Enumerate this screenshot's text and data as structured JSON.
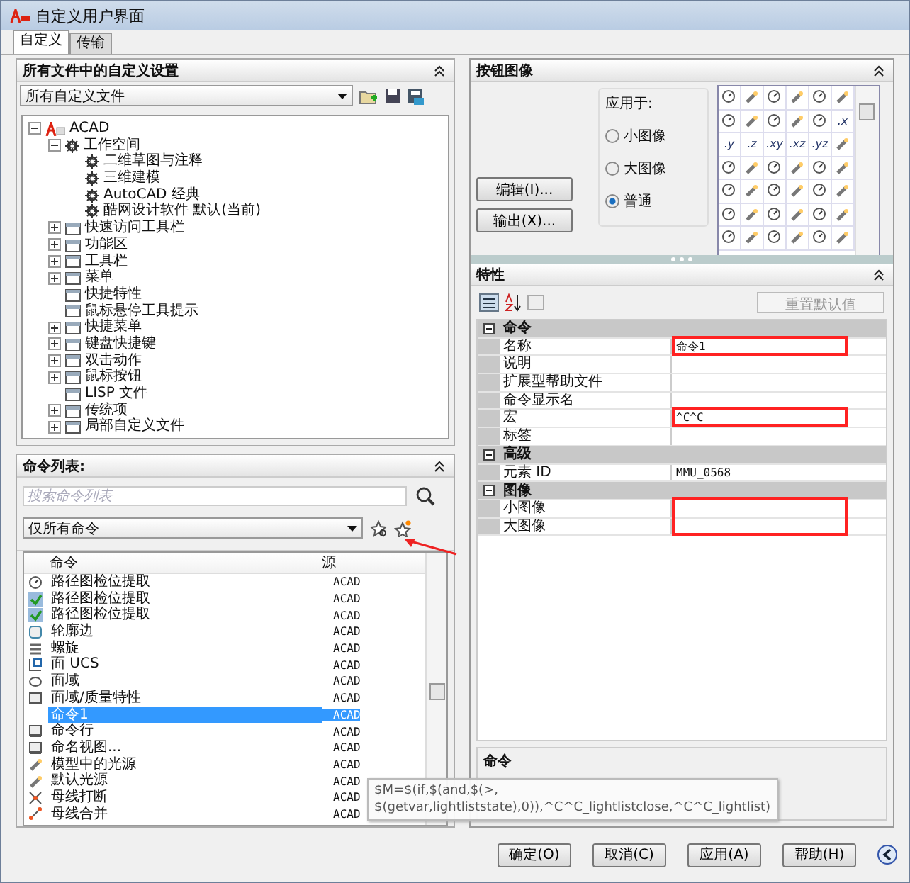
{
  "window": {
    "title": "自定义用户界面"
  },
  "tabs": [
    {
      "label": "自定义",
      "selected": true
    },
    {
      "label": "传输",
      "selected": false
    }
  ],
  "customizations_panel": {
    "title": "所有文件中的自定义设置",
    "file_select": "所有自定义文件",
    "tree": [
      {
        "label": "ACAD",
        "expanded": true,
        "children": [
          {
            "label": "工作空间",
            "expanded": true,
            "children": [
              {
                "label": "二维草图与注释"
              },
              {
                "label": "三维建模"
              },
              {
                "label": "AutoCAD 经典"
              },
              {
                "label": "酷网设计软件 默认(当前)"
              }
            ]
          },
          {
            "label": "快速访问工具栏",
            "expanded": false
          },
          {
            "label": "功能区",
            "expanded": false
          },
          {
            "label": "工具栏",
            "expanded": false
          },
          {
            "label": "菜单",
            "expanded": false
          },
          {
            "label": "快捷特性"
          },
          {
            "label": "鼠标悬停工具提示"
          },
          {
            "label": "快捷菜单",
            "expanded": false
          },
          {
            "label": "键盘快捷键",
            "expanded": false
          },
          {
            "label": "双击动作",
            "expanded": false
          },
          {
            "label": "鼠标按钮",
            "expanded": false
          },
          {
            "label": "LISP 文件"
          },
          {
            "label": "传统项",
            "expanded": false
          },
          {
            "label": "局部自定义文件",
            "expanded": false
          }
        ]
      }
    ]
  },
  "command_list": {
    "title": "命令列表:",
    "search": {
      "placeholder": "搜索命令列表"
    },
    "filter": "仅所有命令",
    "pointer_arrow": true,
    "columns": [
      "命令",
      "源"
    ],
    "rows": [
      {
        "name": "路径图检位提取",
        "source": "ACAD",
        "icon": true,
        "selected": false
      },
      {
        "name": "路径图检位提取",
        "source": "ACAD",
        "icon": true,
        "selected": false
      },
      {
        "name": "路径图检位提取",
        "source": "ACAD",
        "icon": true,
        "selected": false
      },
      {
        "name": "轮廓边",
        "source": "ACAD",
        "icon": true,
        "selected": false
      },
      {
        "name": "螺旋",
        "source": "ACAD",
        "icon": true,
        "selected": false
      },
      {
        "name": "面 UCS",
        "source": "ACAD",
        "icon": true,
        "selected": false
      },
      {
        "name": "面域",
        "source": "ACAD",
        "icon": true,
        "selected": false
      },
      {
        "name": "面域/质量特性",
        "source": "ACAD",
        "icon": true,
        "selected": false
      },
      {
        "name": "命令1",
        "source": "ACAD",
        "icon": false,
        "selected": true
      },
      {
        "name": "命令行",
        "source": "ACAD",
        "icon": true,
        "selected": false
      },
      {
        "name": "命名视图...",
        "source": "ACAD",
        "icon": true,
        "selected": false
      },
      {
        "name": "模型中的光源",
        "source": "ACAD",
        "icon": true,
        "selected": false
      },
      {
        "name": "默认光源",
        "source": "ACAD",
        "icon": true,
        "selected": false
      },
      {
        "name": "母线打断",
        "source": "ACAD",
        "icon": true,
        "selected": false
      },
      {
        "name": "母线合并",
        "source": "ACAD",
        "icon": true,
        "selected": false
      }
    ]
  },
  "button_image_panel": {
    "title": "按钮图像",
    "buttons": [
      "编辑(I)...",
      "输出(X)..."
    ],
    "apply_to_label": "应用于:",
    "apply_to": [
      {
        "label": "小图像",
        "selected": false
      },
      {
        "label": "大图像",
        "selected": false
      },
      {
        "label": "普通",
        "selected": true
      }
    ],
    "images": [
      {
        "kind": "icon"
      },
      {
        "kind": "icon"
      },
      {
        "kind": "icon"
      },
      {
        "kind": "icon"
      },
      {
        "kind": "icon"
      },
      {
        "kind": "icon"
      },
      {
        "kind": "icon"
      },
      {
        "kind": "icon"
      },
      {
        "kind": "icon"
      },
      {
        "kind": "icon"
      },
      {
        "kind": "icon"
      },
      {
        "kind": "text",
        "label": ".x"
      },
      {
        "kind": "text",
        "label": ".y"
      },
      {
        "kind": "text",
        "label": ".z"
      },
      {
        "kind": "text",
        "label": ".xy"
      },
      {
        "kind": "text",
        "label": ".xz"
      },
      {
        "kind": "text",
        "label": ".yz"
      },
      {
        "kind": "icon"
      },
      {
        "kind": "icon"
      },
      {
        "kind": "icon"
      },
      {
        "kind": "icon"
      },
      {
        "kind": "icon"
      },
      {
        "kind": "icon"
      },
      {
        "kind": "icon"
      },
      {
        "kind": "icon"
      },
      {
        "kind": "icon"
      },
      {
        "kind": "icon"
      },
      {
        "kind": "icon"
      },
      {
        "kind": "icon"
      },
      {
        "kind": "icon"
      },
      {
        "kind": "icon"
      },
      {
        "kind": "icon"
      },
      {
        "kind": "icon"
      },
      {
        "kind": "icon"
      },
      {
        "kind": "icon"
      },
      {
        "kind": "icon"
      },
      {
        "kind": "icon"
      },
      {
        "kind": "icon"
      },
      {
        "kind": "icon"
      },
      {
        "kind": "icon"
      },
      {
        "kind": "icon"
      },
      {
        "kind": "icon"
      }
    ]
  },
  "properties_panel": {
    "title": "特性",
    "reset_button": {
      "label": "重置默认值",
      "disabled": true
    },
    "rows": [
      {
        "kind": "category",
        "label": "命令"
      },
      {
        "kind": "property",
        "label": "名称",
        "value": "命令1",
        "highlighted": true
      },
      {
        "kind": "property",
        "label": "说明",
        "highlighted": false
      },
      {
        "kind": "property",
        "label": "扩展型帮助文件",
        "highlighted": false
      },
      {
        "kind": "property",
        "label": "命令显示名",
        "highlighted": false
      },
      {
        "kind": "property",
        "label": "宏",
        "value": "^C^C",
        "highlighted": true
      },
      {
        "kind": "property",
        "label": "标签",
        "highlighted": false
      },
      {
        "kind": "category",
        "label": "高级"
      },
      {
        "kind": "property",
        "label": "元素 ID",
        "value": "MMU_0568",
        "highlighted": false
      },
      {
        "kind": "category",
        "label": "图像"
      },
      {
        "kind": "property",
        "label": "小图像",
        "highlighted": true
      },
      {
        "kind": "property",
        "label": "大图像",
        "highlighted": true
      }
    ],
    "description_title": "命令"
  },
  "tooltip": "$M=$(if,$(and,$(>,\n$(getvar,lightliststate),0)),^C^C_lightlistclose,^C^C_lightlist)",
  "buttons": [
    "确定(O)",
    "取消(C)",
    "应用(A)",
    "帮助(H)"
  ]
}
